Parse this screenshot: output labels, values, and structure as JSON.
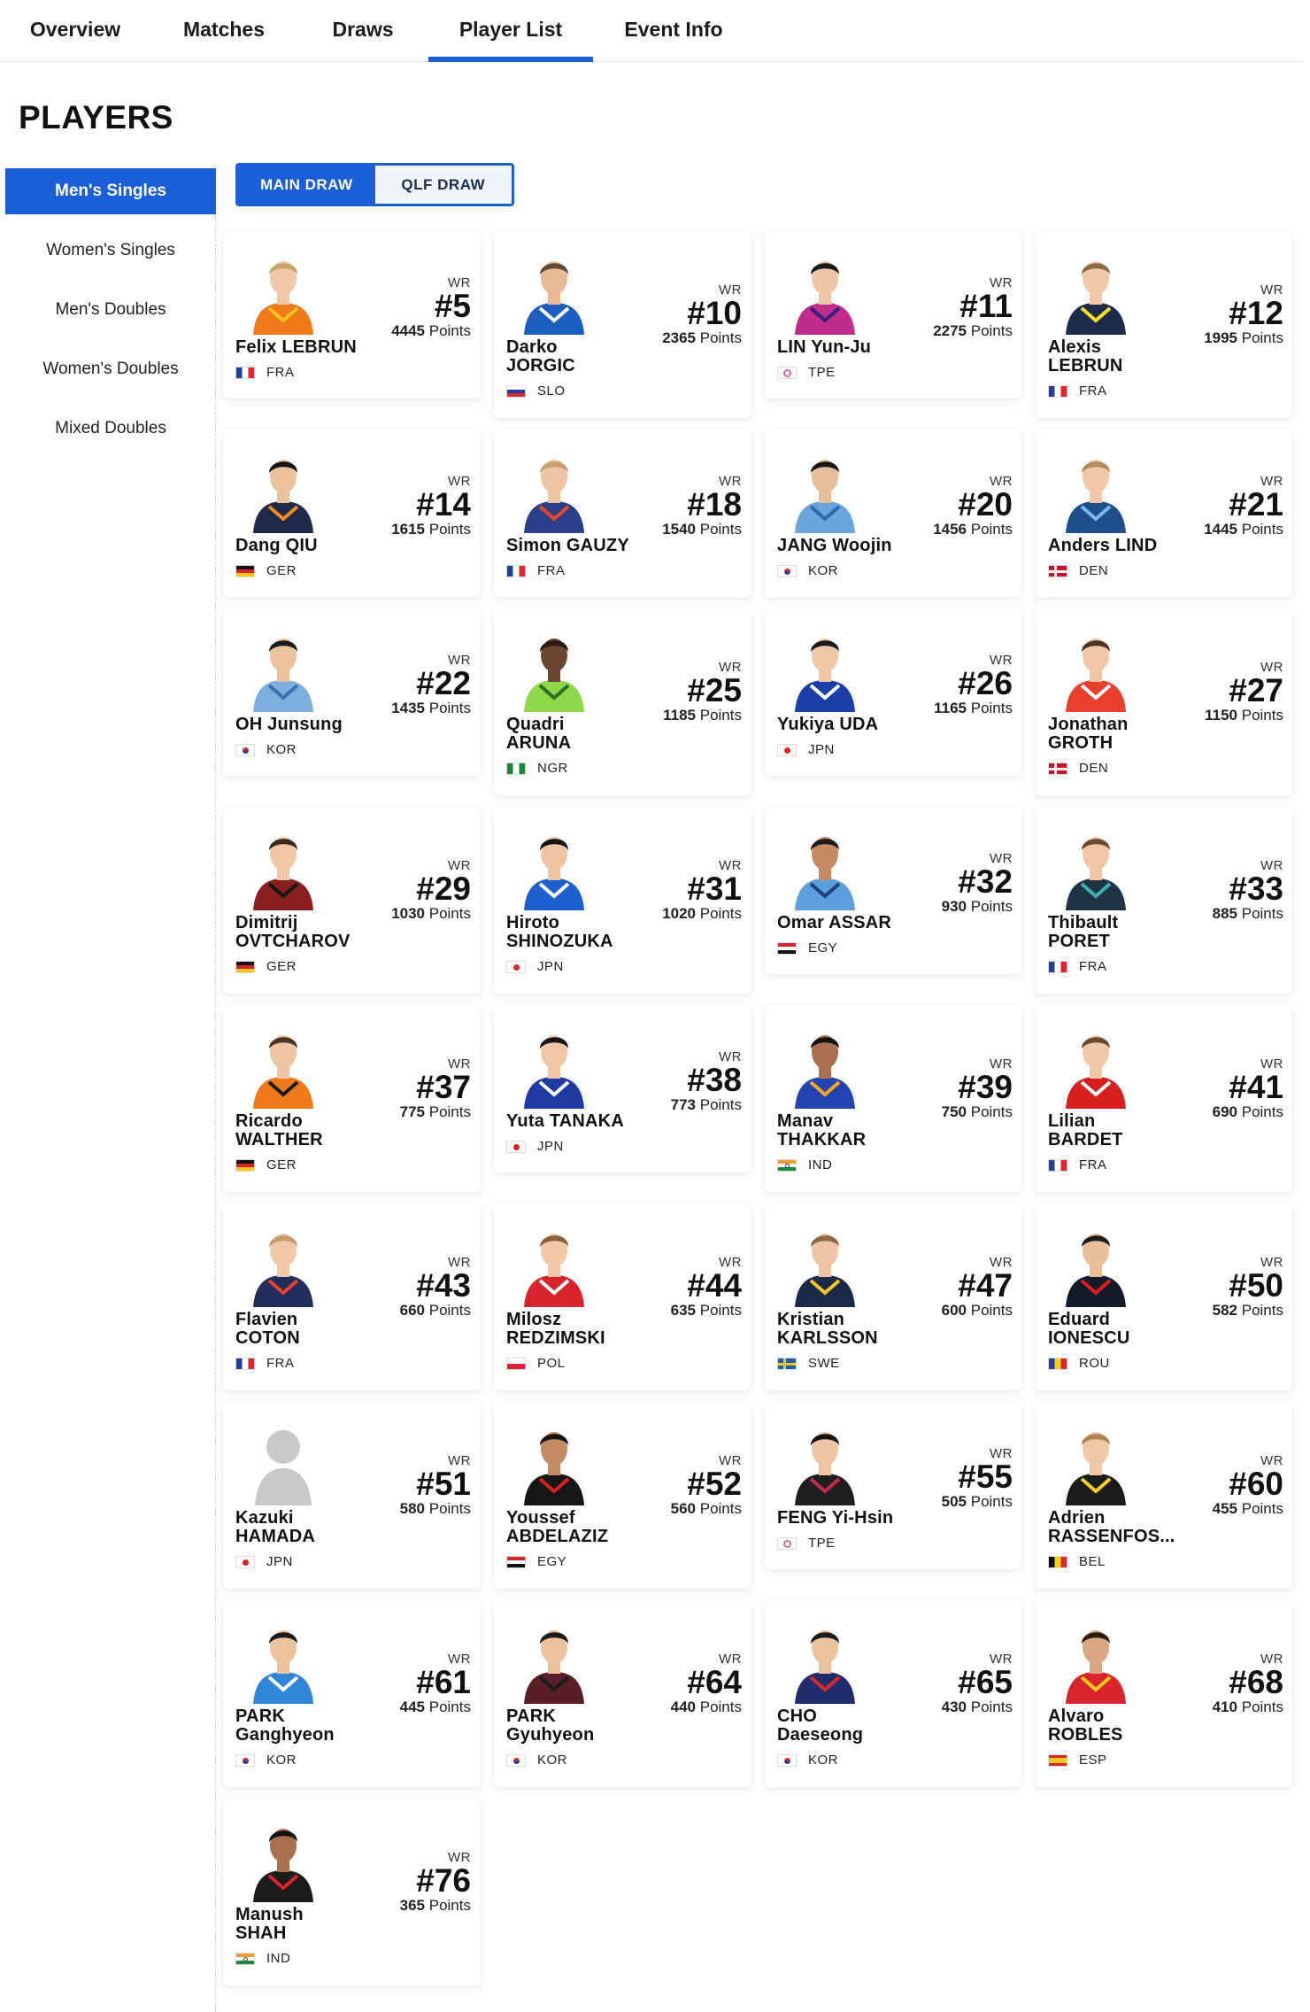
{
  "nav": {
    "tabs": [
      {
        "label": "Overview",
        "active": false
      },
      {
        "label": "Matches",
        "active": false
      },
      {
        "label": "Draws",
        "active": false
      },
      {
        "label": "Player List",
        "active": true
      },
      {
        "label": "Event Info",
        "active": false
      }
    ]
  },
  "page": {
    "title": "PLAYERS"
  },
  "sidebar": {
    "items": [
      {
        "label": "Men's Singles",
        "active": true
      },
      {
        "label": "Women's Singles",
        "active": false
      },
      {
        "label": "Men's Doubles",
        "active": false
      },
      {
        "label": "Women's Doubles",
        "active": false
      },
      {
        "label": "Mixed Doubles",
        "active": false
      }
    ]
  },
  "draw_toggle": {
    "main": "MAIN DRAW",
    "qualifying": "QLF DRAW",
    "selected": "MAIN DRAW"
  },
  "labels": {
    "wr": "WR",
    "points": "Points"
  },
  "players": [
    {
      "first": "Felix",
      "last": "LEBRUN",
      "one_line": true,
      "country": "FRA",
      "rank": "#5",
      "points": "4445",
      "shirt": "#f07a1a",
      "trim": "#f4c21c",
      "skin": "#f1c9a8",
      "hair": "#c9a36a",
      "photo": true
    },
    {
      "first": "Darko",
      "last": "JORGIC",
      "one_line": false,
      "country": "SLO",
      "rank": "#10",
      "points": "2365",
      "shirt": "#1d5fc0",
      "trim": "#ffffff",
      "skin": "#e9b996",
      "hair": "#5a4a3a",
      "photo": true
    },
    {
      "first": "LIN",
      "last": "Yun-Ju",
      "one_line": true,
      "country": "TPE",
      "rank": "#11",
      "points": "2275",
      "shirt": "#c02c8c",
      "trim": "#3a1f7a",
      "skin": "#efc4a2",
      "hair": "#1a1a1a",
      "photo": true
    },
    {
      "first": "Alexis",
      "last": "LEBRUN",
      "one_line": false,
      "country": "FRA",
      "rank": "#12",
      "points": "1995",
      "shirt": "#1d2b4a",
      "trim": "#f5e020",
      "skin": "#f1c9a8",
      "hair": "#8a6a44",
      "photo": true
    },
    {
      "first": "Dang",
      "last": "QIU",
      "one_line": true,
      "country": "GER",
      "rank": "#14",
      "points": "1615",
      "shirt": "#1f2a4a",
      "trim": "#f08a1a",
      "skin": "#ecc29c",
      "hair": "#151515",
      "photo": true
    },
    {
      "first": "Simon",
      "last": "GAUZY",
      "one_line": true,
      "country": "FRA",
      "rank": "#18",
      "points": "1540",
      "shirt": "#2a3f8a",
      "trim": "#e8462a",
      "skin": "#efc4a2",
      "hair": "#c8a070",
      "photo": true
    },
    {
      "first": "JANG",
      "last": "Woojin",
      "one_line": true,
      "country": "KOR",
      "rank": "#20",
      "points": "1456",
      "shirt": "#6aa6dc",
      "trim": "#2d6bb0",
      "skin": "#e9be9a",
      "hair": "#161616",
      "photo": true
    },
    {
      "first": "Anders",
      "last": "LIND",
      "one_line": true,
      "country": "DEN",
      "rank": "#21",
      "points": "1445",
      "shirt": "#1e4f8c",
      "trim": "#7ab8e8",
      "skin": "#f1c9a8",
      "hair": "#b58a5a",
      "photo": true
    },
    {
      "first": "OH",
      "last": "Junsung",
      "one_line": true,
      "country": "KOR",
      "rank": "#22",
      "points": "1435",
      "shirt": "#7eaedd",
      "trim": "#3b6fae",
      "skin": "#ecc29c",
      "hair": "#1c1c1c",
      "photo": true
    },
    {
      "first": "Quadri",
      "last": "ARUNA",
      "one_line": false,
      "country": "NGR",
      "rank": "#25",
      "points": "1185",
      "shirt": "#8ed84a",
      "trim": "#2b6e2a",
      "skin": "#6b4630",
      "hair": "#2a1c14",
      "photo": true
    },
    {
      "first": "Yukiya",
      "last": "UDA",
      "one_line": true,
      "country": "JPN",
      "rank": "#26",
      "points": "1165",
      "shirt": "#1a3fa8",
      "trim": "#ffffff",
      "skin": "#f0c6a4",
      "hair": "#1a1a1a",
      "photo": true
    },
    {
      "first": "Jonathan",
      "last": "GROTH",
      "one_line": false,
      "country": "DEN",
      "rank": "#27",
      "points": "1150",
      "shirt": "#e8402c",
      "trim": "#ffffff",
      "skin": "#f0c6a4",
      "hair": "#4a3422",
      "photo": true
    },
    {
      "first": "Dimitrij",
      "last": "OVTCHAROV",
      "one_line": false,
      "country": "GER",
      "rank": "#29",
      "points": "1030",
      "shirt": "#8a1f1f",
      "trim": "#151515",
      "skin": "#f0c6a4",
      "hair": "#3a2a1c",
      "photo": true
    },
    {
      "first": "Hiroto",
      "last": "SHINOZUKA",
      "one_line": false,
      "country": "JPN",
      "rank": "#31",
      "points": "1020",
      "shirt": "#1e5fd0",
      "trim": "#ffffff",
      "skin": "#efc4a2",
      "hair": "#161616",
      "photo": true
    },
    {
      "first": "Omar",
      "last": "ASSAR",
      "one_line": true,
      "country": "EGY",
      "rank": "#32",
      "points": "930",
      "shirt": "#5aa0dc",
      "trim": "#1f3f7a",
      "skin": "#c48a62",
      "hair": "#1c1c1c",
      "photo": true
    },
    {
      "first": "Thibault",
      "last": "PORET",
      "one_line": false,
      "country": "FRA",
      "rank": "#33",
      "points": "885",
      "shirt": "#1e3344",
      "trim": "#3ab0b0",
      "skin": "#f0c6a4",
      "hair": "#6a4a2e",
      "photo": true
    },
    {
      "first": "Ricardo",
      "last": "WALTHER",
      "one_line": false,
      "country": "GER",
      "rank": "#37",
      "points": "775",
      "shirt": "#f07a1a",
      "trim": "#1b1b1b",
      "skin": "#efc4a2",
      "hair": "#4a3422",
      "photo": true
    },
    {
      "first": "Yuta",
      "last": "TANAKA",
      "one_line": true,
      "country": "JPN",
      "rank": "#38",
      "points": "773",
      "shirt": "#1f3aa0",
      "trim": "#ffffff",
      "skin": "#f0c6a4",
      "hair": "#161616",
      "photo": true
    },
    {
      "first": "Manav",
      "last": "THAKKAR",
      "one_line": false,
      "country": "IND",
      "rank": "#39",
      "points": "750",
      "shirt": "#2344b0",
      "trim": "#f5a623",
      "skin": "#a8704c",
      "hair": "#151515",
      "photo": true
    },
    {
      "first": "Lilian",
      "last": "BARDET",
      "one_line": false,
      "country": "FRA",
      "rank": "#41",
      "points": "690",
      "shirt": "#d81e1e",
      "trim": "#ffffff",
      "skin": "#f1c9a8",
      "hair": "#6a4a2e",
      "photo": true
    },
    {
      "first": "Flavien",
      "last": "COTON",
      "one_line": false,
      "country": "FRA",
      "rank": "#43",
      "points": "660",
      "shirt": "#1f2e5a",
      "trim": "#e8402c",
      "skin": "#f1c9a8",
      "hair": "#c69a6a",
      "photo": true
    },
    {
      "first": "Milosz",
      "last": "REDZIMSKI",
      "one_line": false,
      "country": "POL",
      "rank": "#44",
      "points": "635",
      "shirt": "#d8242a",
      "trim": "#ffffff",
      "skin": "#f1c9a8",
      "hair": "#8a6038",
      "photo": true
    },
    {
      "first": "Kristian",
      "last": "KARLSSON",
      "one_line": false,
      "country": "SWE",
      "rank": "#47",
      "points": "600",
      "shirt": "#1c2a4a",
      "trim": "#f5c61c",
      "skin": "#efc4a2",
      "hair": "#8a6a44",
      "photo": true
    },
    {
      "first": "Eduard",
      "last": "IONESCU",
      "one_line": false,
      "country": "ROU",
      "rank": "#50",
      "points": "582",
      "shirt": "#141a2a",
      "trim": "#d81e1e",
      "skin": "#e9be9a",
      "hair": "#1c1c1c",
      "photo": true
    },
    {
      "first": "Kazuki",
      "last": "HAMADA",
      "one_line": false,
      "country": "JPN",
      "rank": "#51",
      "points": "580",
      "shirt": "#cfcfcf",
      "trim": "#cfcfcf",
      "skin": "#cfcfcf",
      "hair": "#cfcfcf",
      "photo": false
    },
    {
      "first": "Youssef",
      "last": "ABDELAZIZ",
      "one_line": false,
      "country": "EGY",
      "rank": "#52",
      "points": "560",
      "shirt": "#161616",
      "trim": "#d81e1e",
      "skin": "#c48a62",
      "hair": "#151515",
      "photo": true
    },
    {
      "first": "FENG",
      "last": "Yi-Hsin",
      "one_line": true,
      "country": "TPE",
      "rank": "#55",
      "points": "505",
      "shirt": "#1f1f1f",
      "trim": "#c02c4c",
      "skin": "#efc4a2",
      "hair": "#151515",
      "photo": true
    },
    {
      "first": "Adrien",
      "last": "RASSENFOS...",
      "one_line": false,
      "country": "BEL",
      "rank": "#60",
      "points": "455",
      "shirt": "#1b1b1b",
      "trim": "#f5d020",
      "skin": "#f1c9a8",
      "hair": "#b0824e",
      "photo": true
    },
    {
      "first": "PARK",
      "last": "Ganghyeon",
      "one_line": false,
      "country": "KOR",
      "rank": "#61",
      "points": "445",
      "shirt": "#2f86d8",
      "trim": "#ffffff",
      "skin": "#ecc29c",
      "hair": "#1c1c1c",
      "photo": true
    },
    {
      "first": "PARK",
      "last": "Gyuhyeon",
      "one_line": false,
      "country": "KOR",
      "rank": "#64",
      "points": "440",
      "shirt": "#5a1e2a",
      "trim": "#1b1b1b",
      "skin": "#ecc29c",
      "hair": "#1c1c1c",
      "photo": true
    },
    {
      "first": "CHO",
      "last": "Daeseong",
      "one_line": false,
      "country": "KOR",
      "rank": "#65",
      "points": "430",
      "shirt": "#1f2e6a",
      "trim": "#d82a2a",
      "skin": "#ecc29c",
      "hair": "#1c1c1c",
      "photo": true
    },
    {
      "first": "Alvaro",
      "last": "ROBLES",
      "one_line": false,
      "country": "ESP",
      "rank": "#68",
      "points": "410",
      "shirt": "#d8242a",
      "trim": "#f5c61c",
      "skin": "#d8a680",
      "hair": "#2a1c14",
      "photo": true
    },
    {
      "first": "Manush",
      "last": "SHAH",
      "one_line": false,
      "country": "IND",
      "rank": "#76",
      "points": "365",
      "shirt": "#1b1b1b",
      "trim": "#d8242a",
      "skin": "#a8704c",
      "hair": "#151515",
      "photo": true
    }
  ],
  "colors": {
    "accent": "#1a5fd8"
  }
}
